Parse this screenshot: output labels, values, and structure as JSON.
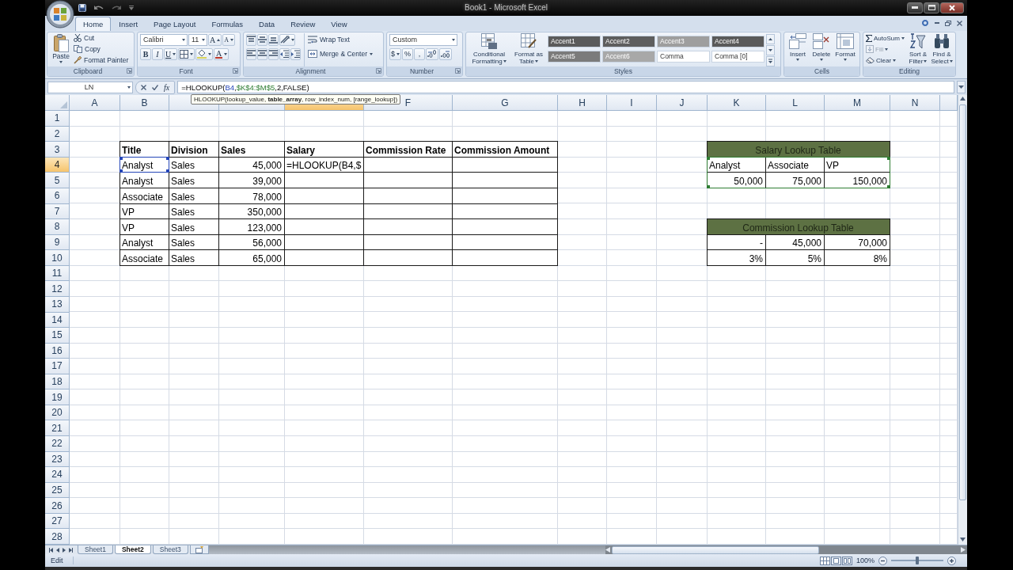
{
  "title_bar": {
    "title": "Book1 - Microsoft Excel"
  },
  "tabs": [
    {
      "label": "Home",
      "selected": true
    },
    {
      "label": "Insert",
      "selected": false
    },
    {
      "label": "Page Layout",
      "selected": false
    },
    {
      "label": "Formulas",
      "selected": false
    },
    {
      "label": "Data",
      "selected": false
    },
    {
      "label": "Review",
      "selected": false
    },
    {
      "label": "View",
      "selected": false
    }
  ],
  "ribbon": {
    "clipboard": {
      "label": "Clipboard",
      "paste": "Paste",
      "tools": [
        {
          "kind": "cut",
          "label": "Cut"
        },
        {
          "kind": "copy",
          "label": "Copy"
        },
        {
          "kind": "painter",
          "label": "Format Painter"
        }
      ]
    },
    "font": {
      "label": "Font",
      "font_name": "Calibri",
      "font_size": "11",
      "grow": "A",
      "shrink": "A",
      "bold": "B",
      "italic": "I",
      "underline": "U",
      "font_color": "A"
    },
    "alignment": {
      "label": "Alignment",
      "wrap_text": "Wrap Text",
      "merge_center": "Merge & Center"
    },
    "number": {
      "label": "Number",
      "format": "Custom",
      "currency": "$",
      "percent": "%",
      "comma": ","
    },
    "styles": {
      "label": "Styles",
      "conditional_formatting": "Conditional Formatting",
      "format_as_table": "Format as Table",
      "gallery": [
        {
          "label": "Accent1",
          "color": "#5b5b5b"
        },
        {
          "label": "Accent2",
          "color": "#5e5e5e"
        },
        {
          "label": "Accent3",
          "color": "#9e9e9e"
        },
        {
          "label": "Accent4",
          "color": "#5a5a5a"
        },
        {
          "label": "Accent5",
          "color": "#7b7b7b"
        },
        {
          "label": "Accent6",
          "color": "#a8a8a8"
        },
        {
          "label": "Comma"
        },
        {
          "label": "Comma [0]"
        }
      ]
    },
    "cells": {
      "label": "Cells",
      "buttons": [
        {
          "kind": "insert",
          "label": "Insert"
        },
        {
          "kind": "delete",
          "label": "Delete"
        },
        {
          "kind": "format",
          "label": "Format"
        }
      ]
    },
    "editing": {
      "label": "Editing",
      "autosum": "AutoSum",
      "fill": {
        "label": "Fill",
        "disabled": true
      },
      "clear": "Clear",
      "sort_filter": "Sort & Filter",
      "find_select": "Find & Select"
    }
  },
  "formula_bar": {
    "name_box": "LN",
    "insert_function": "fx",
    "formula": [
      {
        "text": "=HLOOKUP(",
        "kind": "text"
      },
      {
        "text": "B4",
        "kind": "reference"
      },
      {
        "text": ",",
        "kind": "text"
      },
      {
        "text": "$K$4:$M$5",
        "kind": "reference"
      },
      {
        "text": ",2,FALSE)",
        "kind": "text"
      }
    ]
  },
  "tooltip": "HLOOKUP(lookup_value, **table_array**, row_index_num, [range_lookup])",
  "sheet": {
    "columns": [
      {
        "label": "A",
        "selected": false
      },
      {
        "label": "B",
        "selected": false
      },
      {
        "selected": false
      },
      {
        "selected": false
      },
      {
        "selected": true
      },
      {
        "label": "F",
        "selected": false
      },
      {
        "label": "G",
        "selected": false
      },
      {
        "label": "H",
        "selected": false
      },
      {
        "label": "I",
        "selected": false
      },
      {
        "label": "J",
        "selected": false
      },
      {
        "label": "K",
        "selected": false
      },
      {
        "label": "L",
        "selected": false
      },
      {
        "label": "M",
        "selected": false
      },
      {
        "label": "N",
        "selected": false
      },
      {
        "selected": false
      }
    ],
    "rows": [
      {
        "number": "1",
        "selected": false
      },
      {
        "number": "2",
        "selected": false
      },
      {
        "number": "3",
        "selected": false
      },
      {
        "number": "4",
        "selected": true
      },
      {
        "number": "5",
        "selected": false
      },
      {
        "number": "6",
        "selected": false
      },
      {
        "number": "7",
        "selected": false
      },
      {
        "number": "8",
        "selected": false
      },
      {
        "number": "9",
        "selected": false
      },
      {
        "number": "10",
        "selected": false
      },
      {
        "number": "11",
        "selected": false
      },
      {
        "number": "12",
        "selected": false
      },
      {
        "number": "13",
        "selected": false
      },
      {
        "number": "14",
        "selected": false
      },
      {
        "number": "15",
        "selected": false
      },
      {
        "number": "16",
        "selected": false
      },
      {
        "number": "17",
        "selected": false
      },
      {
        "number": "18",
        "selected": false
      },
      {
        "number": "19",
        "selected": false
      },
      {
        "number": "20",
        "selected": false
      },
      {
        "number": "21",
        "selected": false
      },
      {
        "number": "22",
        "selected": false
      },
      {
        "number": "23",
        "selected": false
      },
      {
        "number": "24",
        "selected": false
      },
      {
        "number": "25",
        "selected": false
      },
      {
        "number": "26",
        "selected": false
      },
      {
        "number": "27",
        "selected": false
      },
      {
        "number": "28",
        "selected": false
      }
    ]
  },
  "sales_table": {
    "headers": [
      "Title",
      "Division",
      "Sales",
      "Salary",
      "Commission Rate",
      "Commission Amount"
    ],
    "rows": [
      {
        "title": "Analyst",
        "division": "Sales",
        "sales": "45,000",
        "salary": "=HLOOKUP(B4,$",
        "referenced": true
      },
      {
        "title": "Analyst",
        "division": "Sales",
        "sales": "39,000",
        "referenced": false
      },
      {
        "title": "Associate",
        "division": "Sales",
        "sales": "78,000",
        "referenced": false
      },
      {
        "title": "VP",
        "division": "Sales",
        "sales": "350,000",
        "referenced": false
      },
      {
        "title": "VP",
        "division": "Sales",
        "sales": "123,000",
        "referenced": false
      },
      {
        "title": "Analyst",
        "division": "Sales",
        "sales": "56,000",
        "referenced": false
      },
      {
        "title": "Associate",
        "division": "Sales",
        "sales": "65,000",
        "referenced": false
      }
    ]
  },
  "lookup_tables": [
    {
      "title": "Salary Lookup Table",
      "referenced": true,
      "rows": [
        {
          "kind": "text",
          "cells": [
            "Analyst",
            "Associate",
            "VP"
          ]
        },
        {
          "kind": "number",
          "cells": [
            "50,000",
            "75,000",
            "150,000"
          ]
        }
      ]
    },
    {
      "title": "Commission Lookup Table",
      "referenced": false,
      "rows": [
        {
          "kind": "number",
          "cells": [
            "-",
            "45,000",
            "70,000"
          ]
        },
        {
          "kind": "number",
          "cells": [
            "3%",
            "5%",
            "8%"
          ]
        }
      ]
    }
  ],
  "sheet_tabs": [
    {
      "label": "Sheet1",
      "selected": false
    },
    {
      "label": "Sheet2",
      "selected": true
    },
    {
      "label": "Sheet3",
      "selected": false
    }
  ],
  "status_bar": {
    "mode": "Edit",
    "zoom": {
      "label": "100%",
      "level": 0.5
    }
  }
}
